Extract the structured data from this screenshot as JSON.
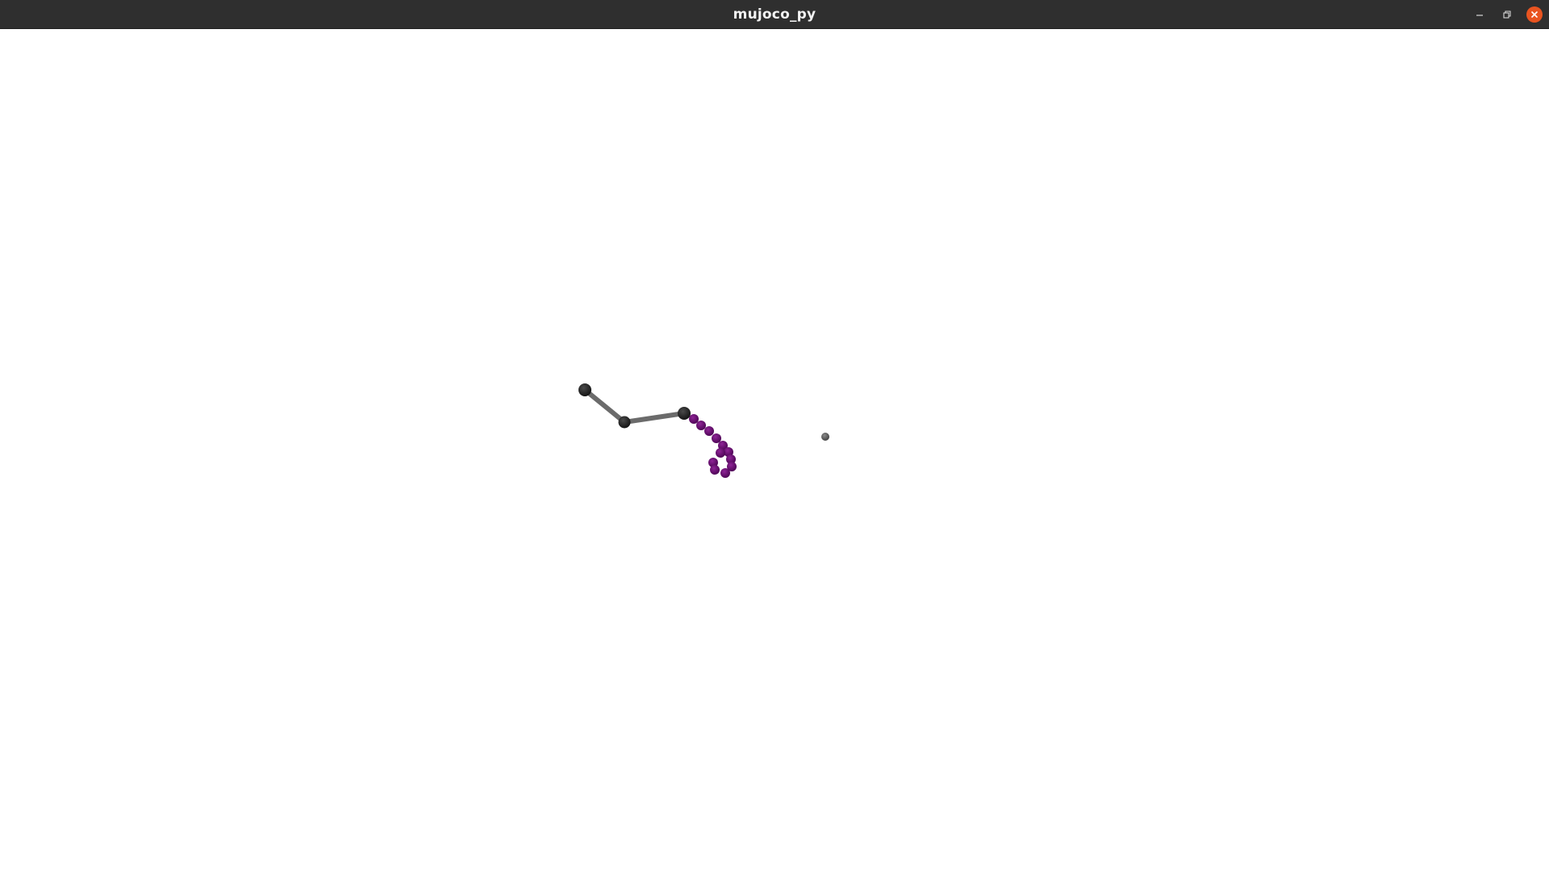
{
  "window": {
    "title": "mujoco_py",
    "controls": {
      "minimize_icon": "minimize-icon",
      "maximize_icon": "restore-icon",
      "close_icon": "close-icon"
    }
  },
  "colors": {
    "titlebar": "#2f2f2f",
    "title_text": "#f2f2f2",
    "close_button": "#e95420",
    "viewport_background": "#ffffff",
    "arm_link": "#6b6b6b",
    "arm_joint": "#1f1f1f",
    "trail": "#6a0a72",
    "target": "#5c5c5c"
  }
}
